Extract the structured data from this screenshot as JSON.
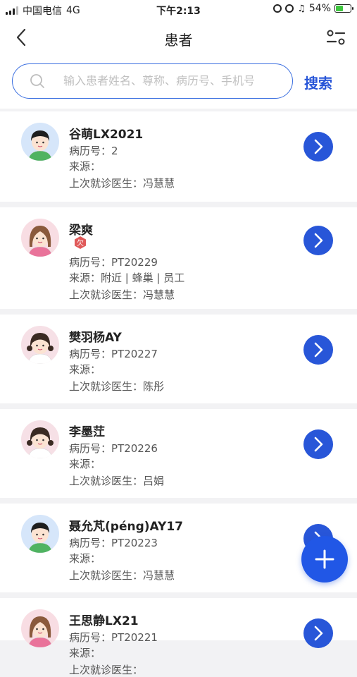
{
  "status_bar": {
    "carrier": "中国电信",
    "network": "4G",
    "time": "下午2:13",
    "battery": "54%",
    "battery_level": 0.54
  },
  "header": {
    "title": "患者",
    "back_icon": "chevron-left-icon",
    "filter_icon": "filter-sliders-icon"
  },
  "search": {
    "placeholder": "输入患者姓名、尊称、病历号、手机号",
    "button": "搜索"
  },
  "labels": {
    "record_no": "病历号：",
    "source": "来源：",
    "last_doctor": "上次就诊医生："
  },
  "patients": [
    {
      "name": "谷萌LX2021",
      "record_no": "2",
      "source": "",
      "doctor": "冯慧慧",
      "tag": ""
    },
    {
      "name": "梁爽",
      "record_no": "PT20229",
      "source": "附近 | 蜂巢 | 员工",
      "doctor": "冯慧慧",
      "tag": "欠"
    },
    {
      "name": "樊羽杨AY",
      "record_no": "PT20227",
      "source": "",
      "doctor": "陈彤",
      "tag": ""
    },
    {
      "name": "李墨茳",
      "record_no": "PT20226",
      "source": "",
      "doctor": "吕娟",
      "tag": ""
    },
    {
      "name": "聂允芃(péng)AY17",
      "record_no": "PT20223",
      "source": "",
      "doctor": "冯慧慧",
      "tag": ""
    },
    {
      "name": "王思静LX21",
      "record_no": "PT20221",
      "source": "",
      "doctor": "",
      "tag": ""
    }
  ],
  "fab": {
    "icon": "plus-icon"
  },
  "colors": {
    "accent": "#2856d8",
    "fab": "#2157e6",
    "tag": "#e05a5a"
  }
}
